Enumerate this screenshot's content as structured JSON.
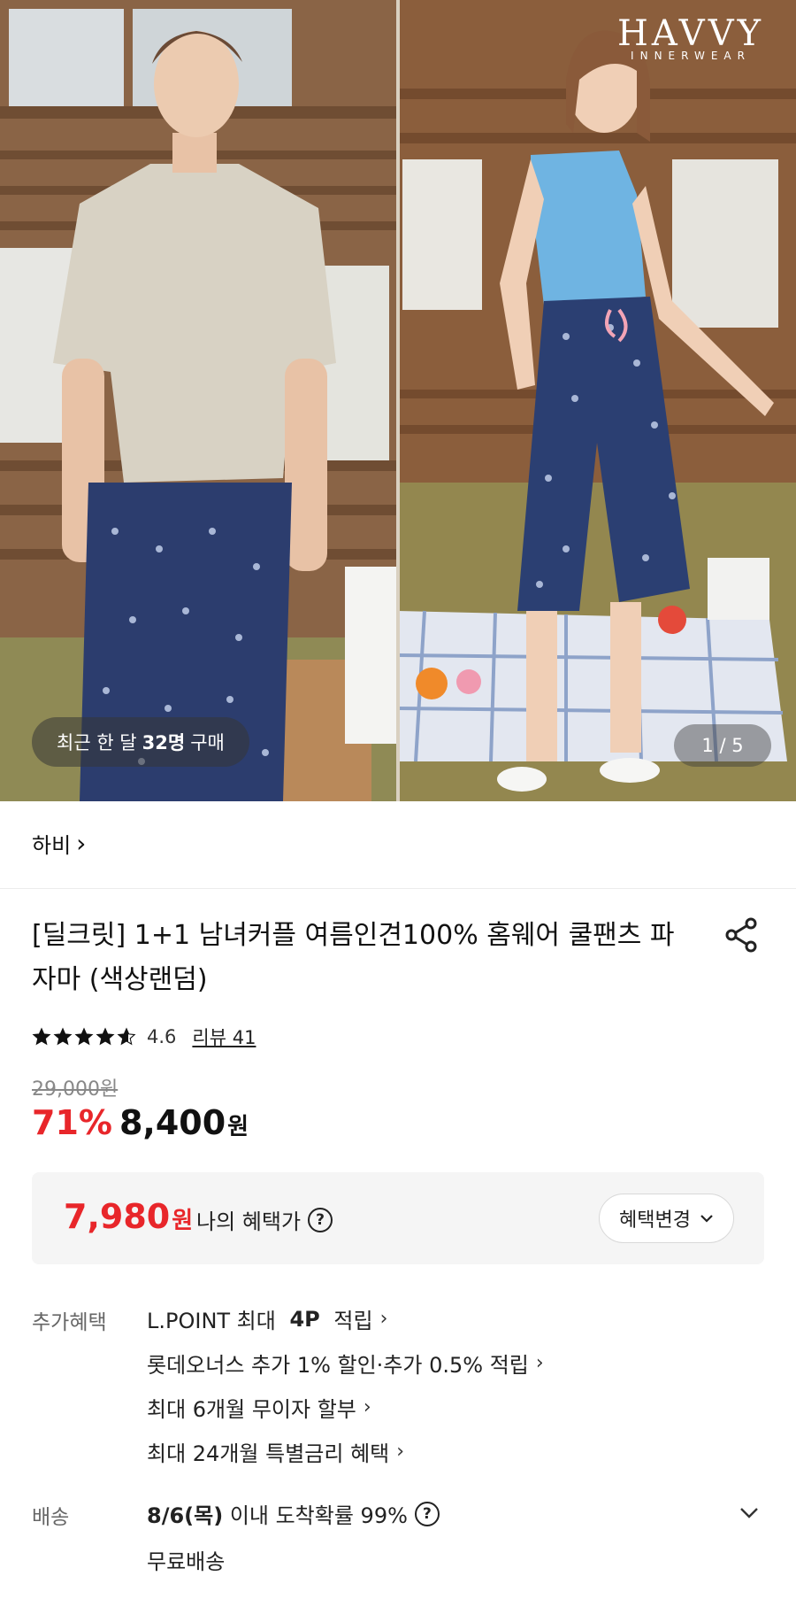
{
  "hero": {
    "brand_logo": "HAVVY",
    "brand_logo_sub": "INNERWEAR",
    "recent_prefix": "최근 한 달",
    "recent_count": "32명",
    "recent_suffix": "구매",
    "page_counter": "1 / 5"
  },
  "store": {
    "name": "하비",
    "chevron": "›"
  },
  "product": {
    "title": "[딜크릿] 1+1 남녀커플 여름인견100% 홈웨어 쿨팬츠 파자마 (색상랜덤)",
    "rating_value": "4.6",
    "rating_stars": 4.6,
    "review_link": "리뷰 41",
    "original_price": "29,000원",
    "discount": "71%",
    "price": "8,400",
    "price_unit": "원"
  },
  "benefit": {
    "price": "7,980",
    "price_unit": "원",
    "label": "나의 혜택가",
    "help": "?",
    "change_button": "혜택변경"
  },
  "extra_benefits": {
    "label": "추가혜택",
    "items": [
      {
        "pre": "L.POINT 최대 ",
        "bold": "4P",
        "post": " 적립"
      },
      {
        "pre": "롯데오너스 추가 1% 할인·추가 0.5% 적립",
        "bold": "",
        "post": ""
      },
      {
        "pre": "최대 6개월 무이자 할부",
        "bold": "",
        "post": ""
      },
      {
        "pre": "최대 24개월 특별금리 혜택",
        "bold": "",
        "post": ""
      }
    ]
  },
  "shipping": {
    "label": "배송",
    "date": "8/6(목)",
    "text": " 이내 도착확률 99%",
    "free": "무료배송"
  },
  "colors": {
    "accent_red": "#e8262a",
    "benefit_bg": "#f5f5f5"
  }
}
